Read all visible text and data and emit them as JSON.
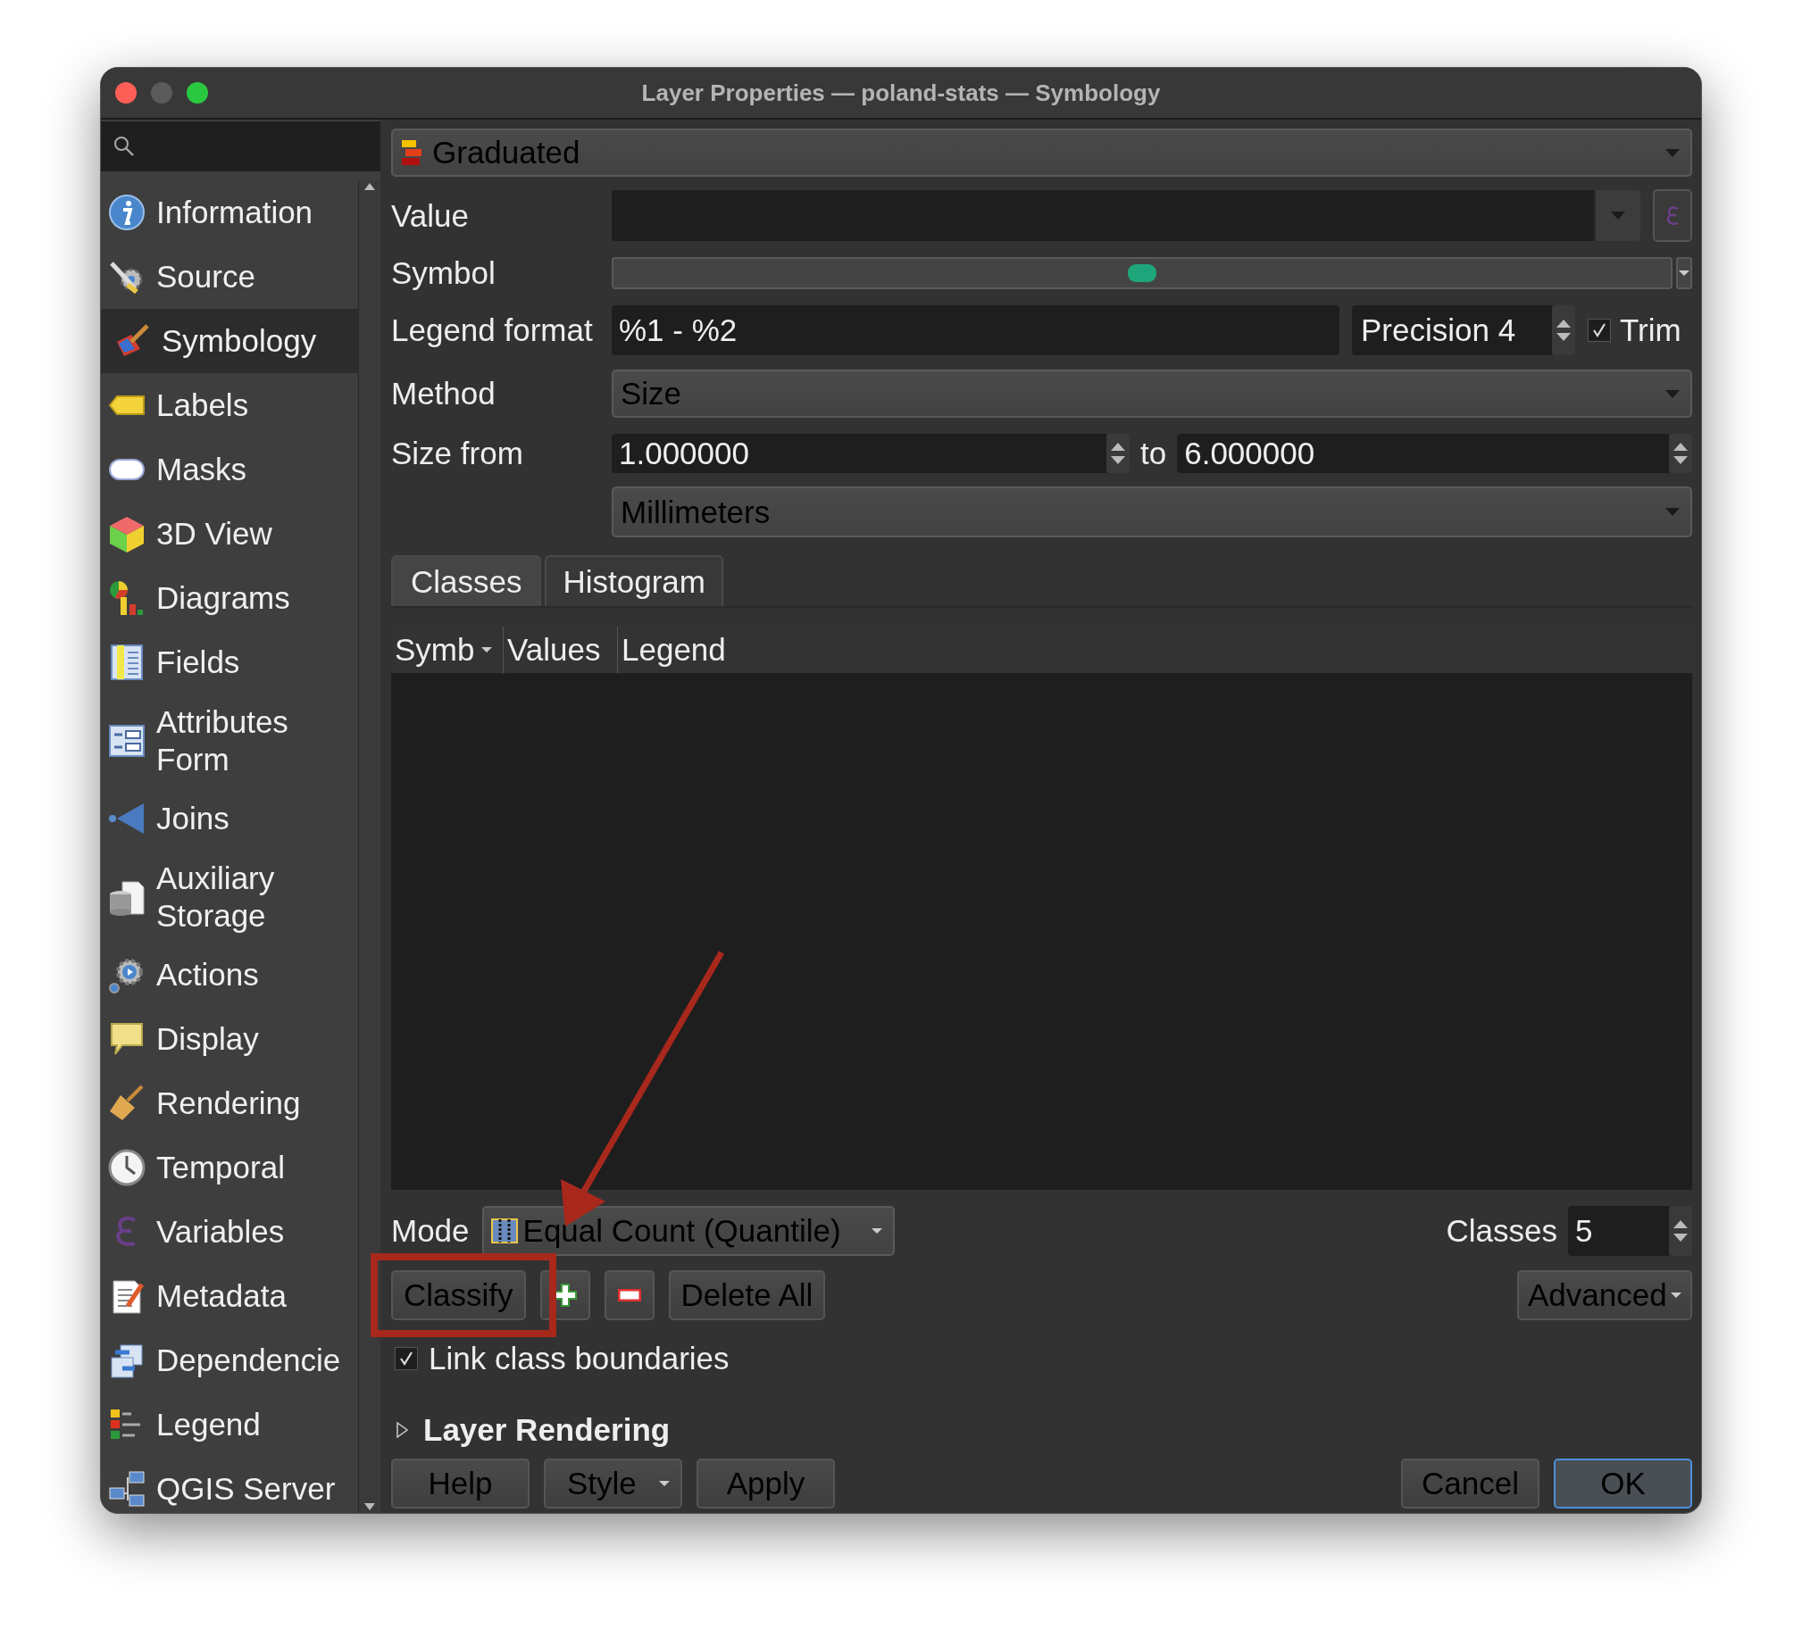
{
  "window": {
    "title": "Layer Properties — poland-stats — Symbology"
  },
  "sidebar": {
    "items": [
      {
        "label": "Information",
        "selected": false
      },
      {
        "label": "Source",
        "selected": false
      },
      {
        "label": "Symbology",
        "selected": true
      },
      {
        "label": "Labels",
        "selected": false
      },
      {
        "label": "Masks",
        "selected": false
      },
      {
        "label": "3D View",
        "selected": false
      },
      {
        "label": "Diagrams",
        "selected": false
      },
      {
        "label": "Fields",
        "selected": false
      },
      {
        "label": "Attributes Form",
        "selected": false
      },
      {
        "label": "Joins",
        "selected": false
      },
      {
        "label": "Auxiliary Storage",
        "selected": false
      },
      {
        "label": "Actions",
        "selected": false
      },
      {
        "label": "Display",
        "selected": false
      },
      {
        "label": "Rendering",
        "selected": false
      },
      {
        "label": "Temporal",
        "selected": false
      },
      {
        "label": "Variables",
        "selected": false
      },
      {
        "label": "Metadata",
        "selected": false
      },
      {
        "label": "Dependencie",
        "selected": false
      },
      {
        "label": "Legend",
        "selected": false
      },
      {
        "label": "QGIS Server",
        "selected": false
      }
    ]
  },
  "renderer": {
    "value": "Graduated"
  },
  "form": {
    "value": {
      "label": "Value"
    },
    "symbol": {
      "label": "Symbol"
    },
    "legend_format": {
      "label": "Legend format",
      "value": "%1 - %2",
      "precision": "Precision 4",
      "trim": {
        "label": "Trim",
        "checked": true
      }
    },
    "method": {
      "label": "Method",
      "value": "Size"
    },
    "size": {
      "label": "Size from",
      "from": "1.000000",
      "to_label": "to",
      "to": "6.000000",
      "unit": "Millimeters"
    }
  },
  "tabs": [
    {
      "label": "Classes",
      "selected": true
    },
    {
      "label": "Histogram",
      "selected": false
    }
  ],
  "table": {
    "columns": [
      "Symb",
      "Values",
      "Legend"
    ]
  },
  "mode": {
    "label": "Mode",
    "value": "Equal Count (Quantile)"
  },
  "classes": {
    "label": "Classes",
    "value": "5"
  },
  "actions": [
    {
      "kind": "text",
      "label": "Classify"
    },
    {
      "kind": "add"
    },
    {
      "kind": "remove"
    },
    {
      "kind": "text",
      "label": "Delete All"
    }
  ],
  "advanced": {
    "label": "Advanced"
  },
  "link_class_boundaries": {
    "label": "Link class boundaries",
    "checked": true
  },
  "layer_rendering": {
    "label": "Layer Rendering",
    "expanded": false
  },
  "footer": {
    "left": [
      {
        "label": "Help",
        "menu": false
      },
      {
        "label": "Style",
        "menu": true
      },
      {
        "label": "Apply",
        "menu": false
      }
    ],
    "right": [
      {
        "label": "Cancel",
        "default": false
      },
      {
        "label": "OK",
        "default": true
      }
    ]
  },
  "annotations": {
    "arrow": true,
    "highlight_frame": true
  }
}
